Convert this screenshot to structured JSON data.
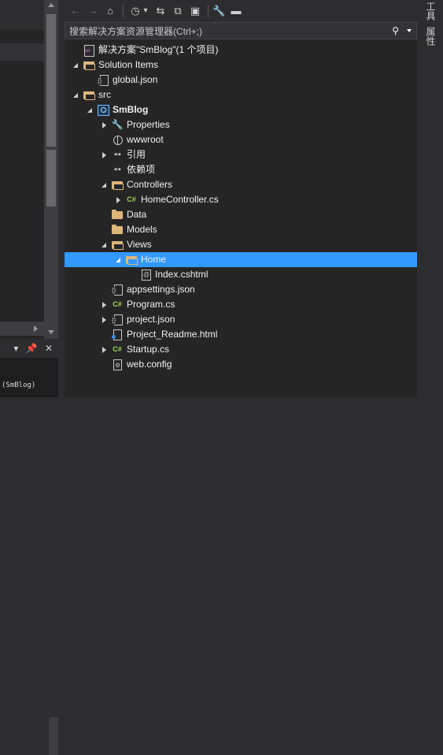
{
  "left_bottom_panel": {
    "header_icons": "▾ 📌 ✕",
    "output_text": "(SmBlog)"
  },
  "toolbar": {
    "back_icon": "←",
    "forward_icon": "→",
    "home_icon": "⌂",
    "history_icon": "◷",
    "history_dropdown_icon": "▾",
    "sync_icon": "⇆",
    "collapse_icon": "⧉",
    "show_all_icon": "▣",
    "properties_icon": "🔧",
    "preview_icon": "▬"
  },
  "search": {
    "placeholder": "搜索解决方案资源管理器(Ctrl+;)",
    "icon": "⚲"
  },
  "tree": [
    {
      "label": "解决方案\"SmBlog\"(1 个项目)",
      "icon": "solution",
      "expand": "none",
      "depth": 0,
      "bold": false
    },
    {
      "label": "Solution Items",
      "icon": "folder-open",
      "expand": "expanded",
      "depth": 0,
      "bold": false
    },
    {
      "label": "global.json",
      "icon": "json",
      "expand": "none",
      "depth": 1,
      "bold": false
    },
    {
      "label": "src",
      "icon": "folder-open",
      "expand": "expanded",
      "depth": 0,
      "bold": false
    },
    {
      "label": "SmBlog",
      "icon": "project",
      "expand": "expanded",
      "depth": 1,
      "bold": true
    },
    {
      "label": "Properties",
      "icon": "wrench",
      "expand": "collapsed",
      "depth": 2,
      "bold": false
    },
    {
      "label": "wwwroot",
      "icon": "globe",
      "expand": "none",
      "depth": 2,
      "bold": false
    },
    {
      "label": "引用",
      "icon": "ref",
      "expand": "collapsed",
      "depth": 2,
      "bold": false
    },
    {
      "label": "依赖项",
      "icon": "ref",
      "expand": "none",
      "depth": 2,
      "bold": false
    },
    {
      "label": "Controllers",
      "icon": "folder-open",
      "expand": "expanded",
      "depth": 2,
      "bold": false
    },
    {
      "label": "HomeController.cs",
      "icon": "csharp",
      "expand": "collapsed",
      "depth": 3,
      "bold": false
    },
    {
      "label": "Data",
      "icon": "folder",
      "expand": "none",
      "depth": 2,
      "bold": false
    },
    {
      "label": "Models",
      "icon": "folder",
      "expand": "none",
      "depth": 2,
      "bold": false
    },
    {
      "label": "Views",
      "icon": "folder-open",
      "expand": "expanded",
      "depth": 2,
      "bold": false
    },
    {
      "label": "Home",
      "icon": "folder-open",
      "expand": "expanded",
      "depth": 3,
      "bold": false,
      "selected": true
    },
    {
      "label": "Index.cshtml",
      "icon": "cshtml",
      "expand": "none",
      "depth": 4,
      "bold": false
    },
    {
      "label": "appsettings.json",
      "icon": "json",
      "expand": "none",
      "depth": 2,
      "bold": false
    },
    {
      "label": "Program.cs",
      "icon": "csharp",
      "expand": "collapsed",
      "depth": 2,
      "bold": false
    },
    {
      "label": "project.json",
      "icon": "json",
      "expand": "collapsed",
      "depth": 2,
      "bold": false
    },
    {
      "label": "Project_Readme.html",
      "icon": "html",
      "expand": "none",
      "depth": 2,
      "bold": false
    },
    {
      "label": "Startup.cs",
      "icon": "csharp",
      "expand": "collapsed",
      "depth": 2,
      "bold": false
    },
    {
      "label": "web.config",
      "icon": "config",
      "expand": "none",
      "depth": 2,
      "bold": false
    }
  ],
  "right_strip": {
    "toolbox_label": "工具",
    "properties_label": "属性"
  },
  "colors": {
    "selection": "#3399ff",
    "background": "#252526",
    "folder": "#dcb67a",
    "csharp": "#9bd65a"
  }
}
